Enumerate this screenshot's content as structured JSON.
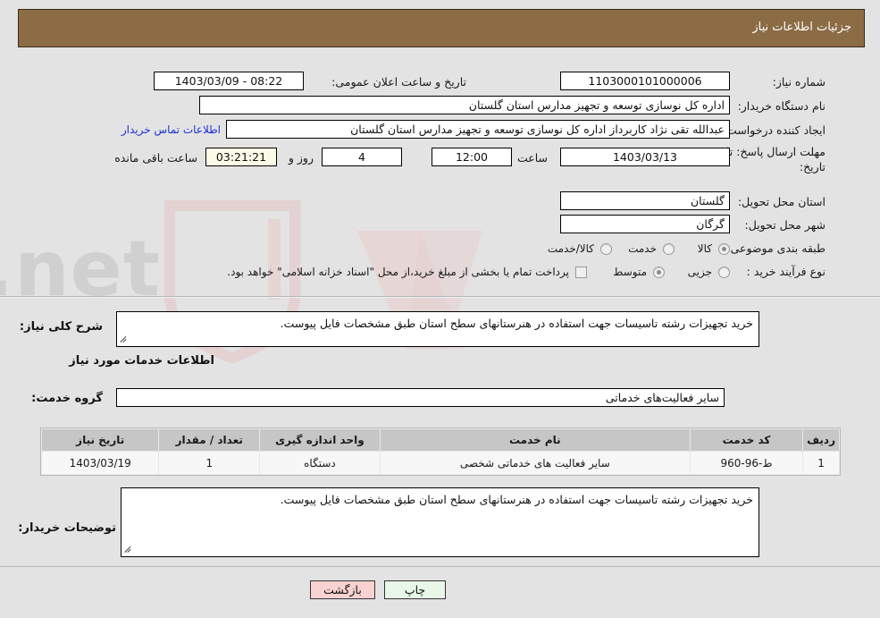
{
  "header": {
    "title": "جزئیات اطلاعات نیاز",
    "bar_color": "#8b6c45"
  },
  "watermark": {
    "text": "AriaTender.net",
    "shield_color": "#f0c9c9"
  },
  "info": {
    "need_number_label": "شماره نیاز:",
    "need_number_value": "1103000101000006",
    "announce_label": "تاریخ و ساعت اعلان عمومی:",
    "announce_value": "08:22 - 1403/03/09",
    "buyer_org_label": "نام دستگاه خریدار:",
    "buyer_org_value": "اداره کل نوسازی  توسعه و تجهیز مدارس استان گلستان",
    "creator_label": "ایجاد کننده درخواست:",
    "creator_value": "عبدالله تقی نژاد کاربرداز اداره کل نوسازی  توسعه و تجهیز مدارس استان گلستان",
    "contact_link": "اطلاعات تماس خریدار",
    "deadline_label_1": "مهلت ارسال پاسخ: تا",
    "deadline_label_2": "تاریخ:",
    "deadline_date": "1403/03/13",
    "hour_label": "ساعت",
    "hour_value": "12:00",
    "days_value": "4",
    "days_label": "روز و",
    "countdown_value": "03:21:21",
    "countdown_label": "ساعت باقی مانده",
    "province_label": "استان محل تحویل:",
    "province_value": "گلستان",
    "city_label": "شهر محل تحویل:",
    "city_value": "گرگان",
    "category_label": "طبقه بندی موضوعی:",
    "category_options": [
      {
        "label": "کالا",
        "selected": true
      },
      {
        "label": "خدمت",
        "selected": false
      },
      {
        "label": "کالا/خدمت",
        "selected": false
      }
    ],
    "process_label": "نوع فرآیند خرید :",
    "process_options": [
      {
        "label": "جزیی",
        "selected": false
      },
      {
        "label": "متوسط",
        "selected": true
      }
    ],
    "payment_checkbox_checked": false,
    "payment_note": "پرداخت تمام یا بخشی از مبلغ خرید،از محل \"اسناد خزانه اسلامی\" خواهد بود."
  },
  "need_summary": {
    "label": "شرح کلی نیاز:",
    "value": "خرید تجهیزات رشته تاسیسات جهت استفاده در هنرستانهای سطح استان طبق مشخصات فایل پیوست."
  },
  "services_section": {
    "title": "اطلاعات خدمات مورد نیاز",
    "group_label": "گروه خدمت:",
    "group_value": "سایر فعالیت‌های خدماتی"
  },
  "table": {
    "headers": [
      "ردیف",
      "کد خدمت",
      "نام خدمت",
      "واحد اندازه گیری",
      "تعداد / مقدار",
      "تاریخ نیاز"
    ],
    "rows": [
      {
        "index": "1",
        "code": "ط-96-960",
        "name": "سایر فعالیت های خدماتی شخصی",
        "unit": "دستگاه",
        "quantity": "1",
        "date": "1403/03/19"
      }
    ]
  },
  "buyer_notes": {
    "label": "توضیحات خریدار:",
    "value": "خرید تجهیزات رشته تاسیسات جهت استفاده در هنرستانهای سطح استان طبق مشخصات فایل پیوست."
  },
  "footer": {
    "print_label": "چاپ",
    "back_label": "بازگشت"
  }
}
